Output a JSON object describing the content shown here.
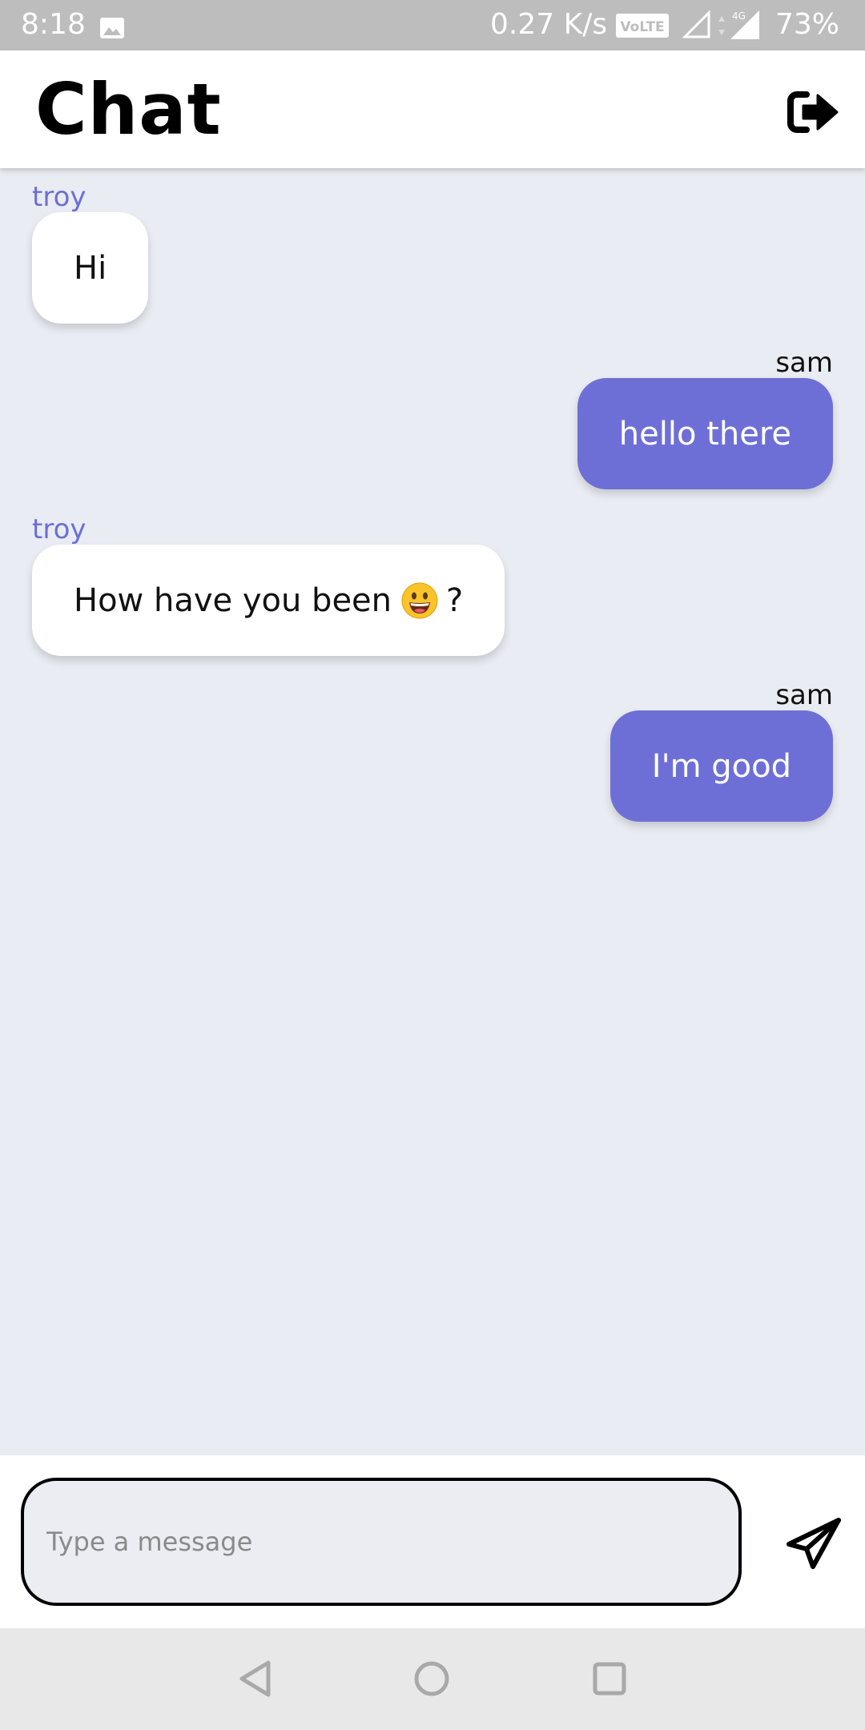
{
  "status_bar": {
    "time": "8:18",
    "gallery_icon": "image-icon",
    "network_speed": "0.27 K/s",
    "volte_label": "VoLTE",
    "network_type": "4G",
    "battery": "73%"
  },
  "header": {
    "title": "Chat",
    "logout_icon": "sign-out-icon"
  },
  "messages": [
    {
      "sender": "troy",
      "text": "Hi",
      "own": false
    },
    {
      "sender": "sam",
      "text": "hello there",
      "own": true
    },
    {
      "sender": "troy",
      "text_before_emoji": "How have you been",
      "emoji": "grinning-face",
      "text_after_emoji": "?",
      "own": false
    },
    {
      "sender": "sam",
      "text": "I'm good",
      "own": true
    }
  ],
  "composer": {
    "placeholder": "Type a message",
    "value": "",
    "send_icon": "paper-plane-icon"
  },
  "nav_bar": {
    "back_icon": "back-triangle-icon",
    "home_icon": "home-circle-icon",
    "recents_icon": "recents-square-icon"
  },
  "colors": {
    "accent": "#6e6fd6",
    "other_sender_name": "#6c6fd4",
    "chat_background": "#e9ecf2",
    "status_bar": "#bdbdbd",
    "nav_bar": "#e8e8e8"
  }
}
